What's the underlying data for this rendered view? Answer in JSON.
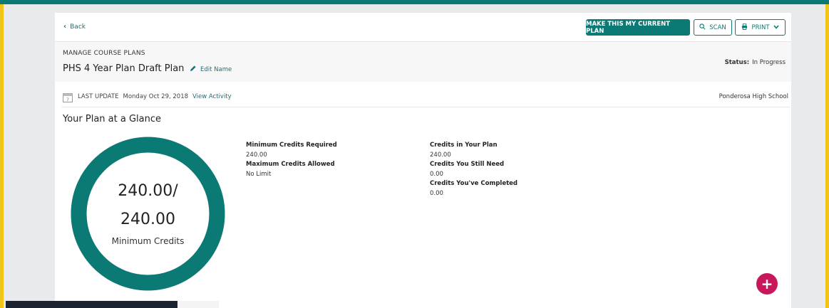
{
  "header": {
    "back_label": "Back",
    "make_current_label": "MAKE THIS MY CURRENT PLAN",
    "scan_label": "SCAN",
    "print_label": "PRINT"
  },
  "plan": {
    "section_label": "MANAGE COURSE PLANS",
    "title": "PHS 4 Year Plan Draft Plan",
    "edit_label": "Edit Name",
    "status_label": "Status:",
    "status_value": "In Progress"
  },
  "update": {
    "label": "LAST UPDATE",
    "date": "Monday Oct 29, 2018",
    "activity_link": "View Activity",
    "school": "Ponderosa High School"
  },
  "glance": {
    "heading": "Your Plan at a Glance",
    "ring_line1": "240.00/",
    "ring_line2": "240.00",
    "ring_sub": "Minimum Credits",
    "ring_fill": 1.0
  },
  "stats": {
    "min_required_label": "Minimum Credits Required",
    "min_required_value": "240.00",
    "max_allowed_label": "Maximum Credits Allowed",
    "max_allowed_value": "No Limit",
    "in_plan_label": "Credits in Your Plan",
    "in_plan_value": "240.00",
    "still_need_label": "Credits You Still Need",
    "still_need_value": "0.00",
    "completed_label": "Credits You've Completed",
    "completed_value": "0.00"
  },
  "fab": {
    "label": "+"
  },
  "colors": {
    "accent": "#0b7a75",
    "fab": "#c8175a",
    "frame": "#f0c419"
  }
}
